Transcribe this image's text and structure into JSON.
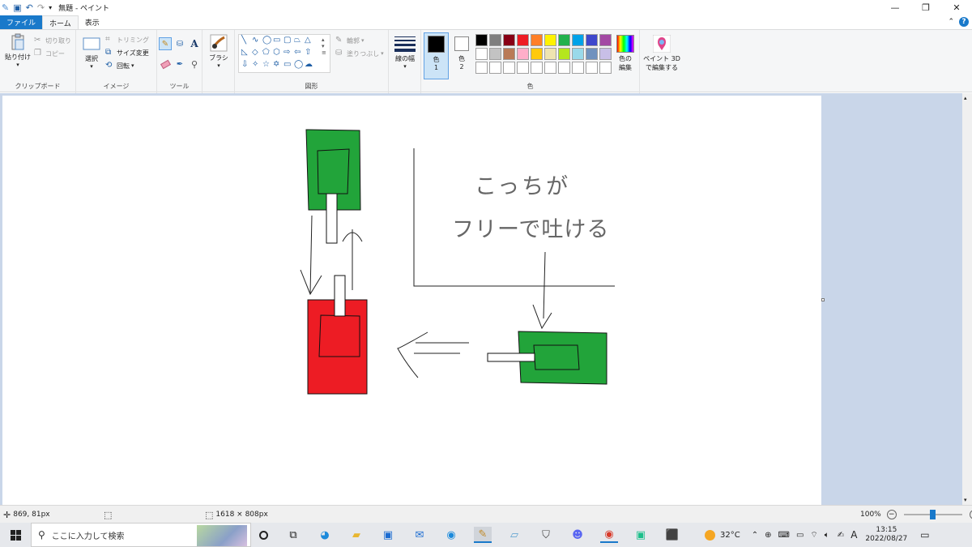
{
  "window": {
    "title": "無題 - ペイント"
  },
  "tabs": {
    "file": "ファイル",
    "home": "ホーム",
    "view": "表示"
  },
  "clipboard": {
    "paste": "貼り付け",
    "cut": "切り取り",
    "copy": "コピー",
    "label": "クリップボード"
  },
  "image": {
    "select": "選択",
    "crop": "トリミング",
    "resize": "サイズ変更",
    "rotate": "回転",
    "label": "イメージ"
  },
  "tools": {
    "label": "ツール"
  },
  "brushes": {
    "label": "ブラシ"
  },
  "shapes": {
    "outline": "輪郭",
    "fill": "塗りつぶし",
    "label": "図形"
  },
  "size": {
    "label": "線の幅"
  },
  "colors": {
    "color1": "色\n1",
    "color1_a": "色",
    "color1_b": "1",
    "color2_a": "色",
    "color2_b": "2",
    "edit_a": "色の",
    "edit_b": "編集",
    "label": "色",
    "primary": "#000000",
    "secondary": "#ffffff",
    "palette_row1": [
      "#000000",
      "#7f7f7f",
      "#880015",
      "#ed1c24",
      "#ff7f27",
      "#fff200",
      "#22b14c",
      "#00a2e8",
      "#3f48cc",
      "#a349a4"
    ],
    "palette_row2": [
      "#ffffff",
      "#c3c3c3",
      "#b97a57",
      "#ffaec9",
      "#ffc90e",
      "#efe4b0",
      "#b5e61d",
      "#99d9ea",
      "#7092be",
      "#c8bfe7"
    ],
    "palette_row3": [
      "#ffffff",
      "#ffffff",
      "#ffffff",
      "#ffffff",
      "#ffffff",
      "#ffffff",
      "#ffffff",
      "#ffffff",
      "#ffffff",
      "#ffffff"
    ]
  },
  "paint3d": {
    "line1": "ペイント 3D",
    "line2": "で編集する"
  },
  "drawing": {
    "handwriting_line1": "こっちが",
    "handwriting_line2": "フリーで吐ける",
    "tank_green": "#22a43a",
    "tank_red": "#ed1c24"
  },
  "status": {
    "cursor": "869, 81px",
    "canvas_size": "1618 × 808px",
    "zoom": "100%",
    "zoom_level": 0.5
  },
  "taskbar": {
    "search_placeholder": "ここに入力して検索",
    "weather": "32°C",
    "ime": "A",
    "time": "13:15",
    "date": "2022/08/27"
  }
}
